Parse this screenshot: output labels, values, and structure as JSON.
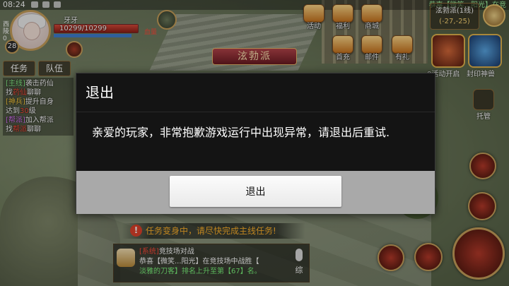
{
  "status_bar": {
    "time": "08:24",
    "right_text": "恭喜【微笑...阳光】在竞"
  },
  "player": {
    "name": "牙牙",
    "hp_text": "10299/10299",
    "hp_fraction": 1.0,
    "level": "28",
    "side_label": "西陵",
    "side_num": "0",
    "blood_tag": "血量"
  },
  "top_menu": {
    "activity": "活动",
    "welfare": "福利",
    "shop": "商城",
    "first_charge": "首充",
    "mail": "邮件",
    "gift": "有礼",
    "zone_name": "泫勃派(1线)",
    "zone_coords": "(-27,-25)",
    "boss_left_label": "0活动开启",
    "boss_right_label": "封印神兽"
  },
  "sect_banner": "泫勃派",
  "tabs": {
    "task": "任务",
    "team": "队伍"
  },
  "quests": [
    {
      "tag": "[主线]",
      "tag_class": "",
      "line1": "袭击药仙",
      "line2_pre": "找",
      "line2_hot": "药仙",
      "line2_post": "聊聊"
    },
    {
      "tag": "[神兵]",
      "tag_class": "y",
      "line1": "提升自身",
      "line2_pre": "达到",
      "line2_hot": "30",
      "line2_post": "级"
    },
    {
      "tag": "[帮派]",
      "tag_class": "p",
      "line1": "加入帮派",
      "line2_pre": "找",
      "line2_hot": "帮派",
      "line2_post": "聊聊"
    }
  ],
  "dialog": {
    "title": "退出",
    "message": "亲爱的玩家，非常抱歉游戏运行中出现异常，请退出后重试.",
    "button": "退出"
  },
  "notice": "任务变身中，请尽快完成主线任务!",
  "chat": {
    "line1_sys": "[系统]",
    "line1_rest": "竞技场对战",
    "line2": "恭喜【微笑...阳光】在竞技场中战胜【",
    "line3": "淡雅的刀客】排名上升至第【67】名。",
    "mic_label": "综"
  },
  "deploy_label": "托管"
}
